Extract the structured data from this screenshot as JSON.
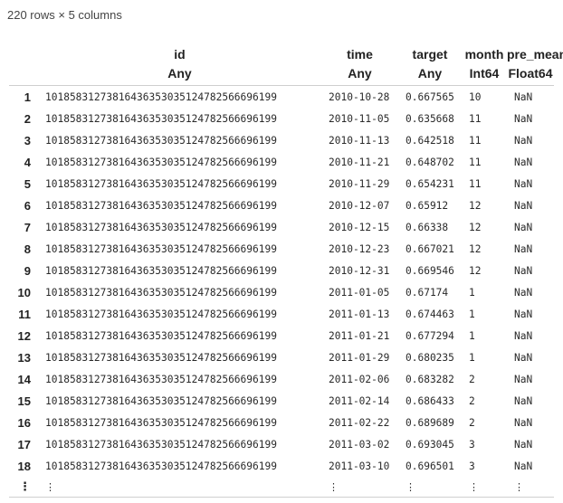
{
  "summary": "220 rows × 5 columns",
  "columns": [
    {
      "name": "id",
      "type": "Any"
    },
    {
      "name": "time",
      "type": "Any"
    },
    {
      "name": "target",
      "type": "Any"
    },
    {
      "name": "month",
      "type": "Int64"
    },
    {
      "name": "pre_mean",
      "type": "Float64"
    }
  ],
  "rows": [
    [
      "1",
      "101858312738164363530351247825666961​99",
      "2010-10-28",
      "0.667565",
      "10",
      "NaN"
    ],
    [
      "2",
      "10185831273816436353035124782566696199",
      "2010-11-05",
      "0.635668",
      "11",
      "NaN"
    ],
    [
      "3",
      "10185831273816436353035124782566696199",
      "2010-11-13",
      "0.642518",
      "11",
      "NaN"
    ],
    [
      "4",
      "10185831273816436353035124782566696199",
      "2010-11-21",
      "0.648702",
      "11",
      "NaN"
    ],
    [
      "5",
      "10185831273816436353035124782566696199",
      "2010-11-29",
      "0.654231",
      "11",
      "NaN"
    ],
    [
      "6",
      "10185831273816436353035124782566696199",
      "2010-12-07",
      "0.65912",
      "12",
      "NaN"
    ],
    [
      "7",
      "10185831273816436353035124782566696199",
      "2010-12-15",
      "0.66338",
      "12",
      "NaN"
    ],
    [
      "8",
      "10185831273816436353035124782566696199",
      "2010-12-23",
      "0.667021",
      "12",
      "NaN"
    ],
    [
      "9",
      "10185831273816436353035124782566696199",
      "2010-12-31",
      "0.669546",
      "12",
      "NaN"
    ],
    [
      "10",
      "10185831273816436353035124782566696199",
      "2011-01-05",
      "0.67174",
      "1",
      "NaN"
    ],
    [
      "11",
      "10185831273816436353035124782566696199",
      "2011-01-13",
      "0.674463",
      "1",
      "NaN"
    ],
    [
      "12",
      "10185831273816436353035124782566696199",
      "2011-01-21",
      "0.677294",
      "1",
      "NaN"
    ],
    [
      "13",
      "10185831273816436353035124782566696199",
      "2011-01-29",
      "0.680235",
      "1",
      "NaN"
    ],
    [
      "14",
      "10185831273816436353035124782566696199",
      "2011-02-06",
      "0.683282",
      "2",
      "NaN"
    ],
    [
      "15",
      "10185831273816436353035124782566696199",
      "2011-02-14",
      "0.686433",
      "2",
      "NaN"
    ],
    [
      "16",
      "10185831273816436353035124782566696199",
      "2011-02-22",
      "0.689689",
      "2",
      "NaN"
    ],
    [
      "17",
      "10185831273816436353035124782566696199",
      "2011-03-02",
      "0.693045",
      "3",
      "NaN"
    ],
    [
      "18",
      "10185831273816436353035124782566696199",
      "2011-03-10",
      "0.696501",
      "3",
      "NaN"
    ]
  ],
  "ellipsis_row": [
    "⋮",
    "⋮",
    "⋮",
    "⋮",
    "⋮",
    "⋮"
  ]
}
